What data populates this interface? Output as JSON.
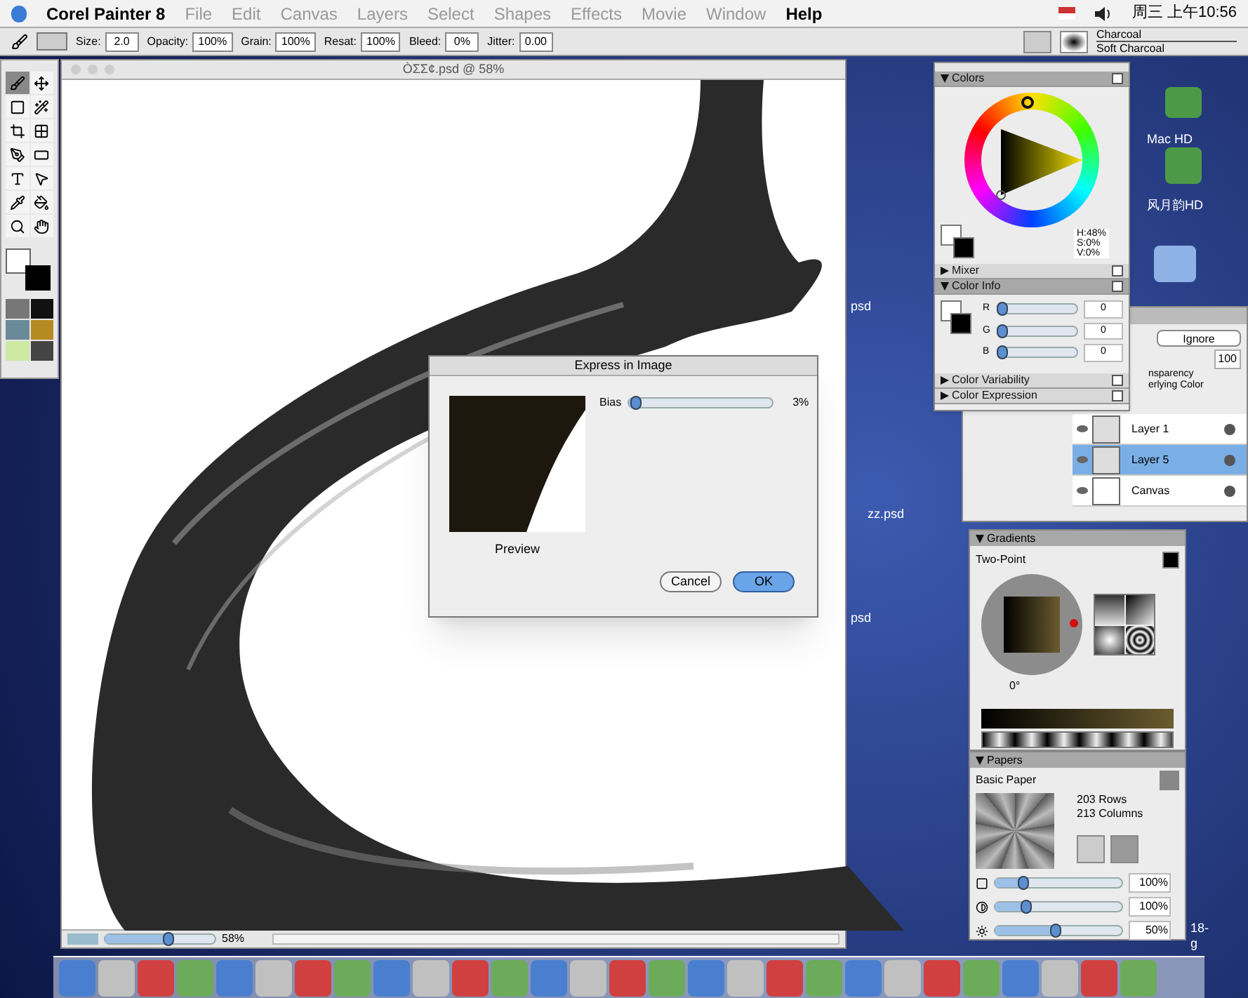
{
  "menubar": {
    "app": "Corel Painter 8",
    "menus": [
      {
        "label": "File",
        "enabled": false
      },
      {
        "label": "Edit",
        "enabled": false
      },
      {
        "label": "Canvas",
        "enabled": false
      },
      {
        "label": "Layers",
        "enabled": false
      },
      {
        "label": "Select",
        "enabled": false
      },
      {
        "label": "Shapes",
        "enabled": false
      },
      {
        "label": "Effects",
        "enabled": false
      },
      {
        "label": "Movie",
        "enabled": false
      },
      {
        "label": "Window",
        "enabled": false
      },
      {
        "label": "Help",
        "enabled": true
      }
    ],
    "clock": "周三 上午10:56"
  },
  "property_bar": {
    "fields": [
      {
        "label": "Size:",
        "value": "2.0"
      },
      {
        "label": "Opacity:",
        "value": "100%"
      },
      {
        "label": "Grain:",
        "value": "100%"
      },
      {
        "label": "Resat:",
        "value": "100%"
      },
      {
        "label": "Bleed:",
        "value": "0%"
      },
      {
        "label": "Jitter:",
        "value": "0.00"
      }
    ],
    "brush_category": "Charcoal",
    "brush_variant": "Soft Charcoal"
  },
  "toolbox": {
    "tools": [
      {
        "selected": true
      },
      {
        "selected": false
      },
      {
        "selected": false
      },
      {
        "selected": false
      },
      {
        "selected": false
      },
      {
        "selected": false
      },
      {
        "selected": false
      },
      {
        "selected": false
      },
      {
        "selected": false
      },
      {
        "selected": false
      },
      {
        "selected": false
      },
      {
        "selected": false
      },
      {
        "selected": false
      },
      {
        "selected": false
      }
    ]
  },
  "document": {
    "title": "ÒΣΣ¢.psd @ 58%",
    "zoom": "58%"
  },
  "dialog": {
    "title": "Express in Image",
    "preview_label": "Preview",
    "slider": {
      "label": "Bias",
      "level": 0.03,
      "reading": "3%"
    },
    "buttons": [
      {
        "label": "Cancel",
        "default": false
      },
      {
        "label": "OK",
        "default": true
      }
    ]
  },
  "desktop_labels": [
    "Mac HD",
    "风月韵HD",
    "psd",
    "zz.psd",
    "psd",
    "18-",
    "g"
  ],
  "color_panels": [
    {
      "kind": "colors",
      "title": "Colors",
      "expanded": true,
      "readout": [
        "H:48%",
        "S:0%",
        "V:0%"
      ]
    },
    {
      "title": "Mixer",
      "expanded": false
    },
    {
      "kind": "color_info",
      "title": "Color Info",
      "expanded": true,
      "channels": [
        {
          "label": "R",
          "level": 0.02,
          "value": "0"
        },
        {
          "label": "G",
          "level": 0.02,
          "value": "0"
        },
        {
          "label": "B",
          "level": 0.02,
          "value": "0"
        }
      ]
    },
    {
      "title": "Color Variability",
      "expanded": false
    },
    {
      "title": "Color Expression",
      "expanded": false
    }
  ],
  "layers": {
    "composite": "Ignore",
    "opacity": "100",
    "options": [
      "nsparency",
      "erlying Color"
    ],
    "items": [
      {
        "name": "Layer 1",
        "selected": false,
        "kind": "layer"
      },
      {
        "name": "Layer 5",
        "selected": true,
        "kind": "layer"
      },
      {
        "name": "Canvas",
        "selected": false,
        "kind": "canvas"
      }
    ]
  },
  "gradients": {
    "title": "Gradients",
    "name": "Two-Point",
    "angle": "0°"
  },
  "papers": {
    "title": "Papers",
    "name": "Basic Paper",
    "rows": "203 Rows",
    "columns": "213 Columns",
    "sliders": [
      {
        "level": 0.2,
        "reading": "100%"
      },
      {
        "level": 0.22,
        "reading": "100%"
      },
      {
        "level": 0.45,
        "reading": "50%"
      }
    ]
  }
}
